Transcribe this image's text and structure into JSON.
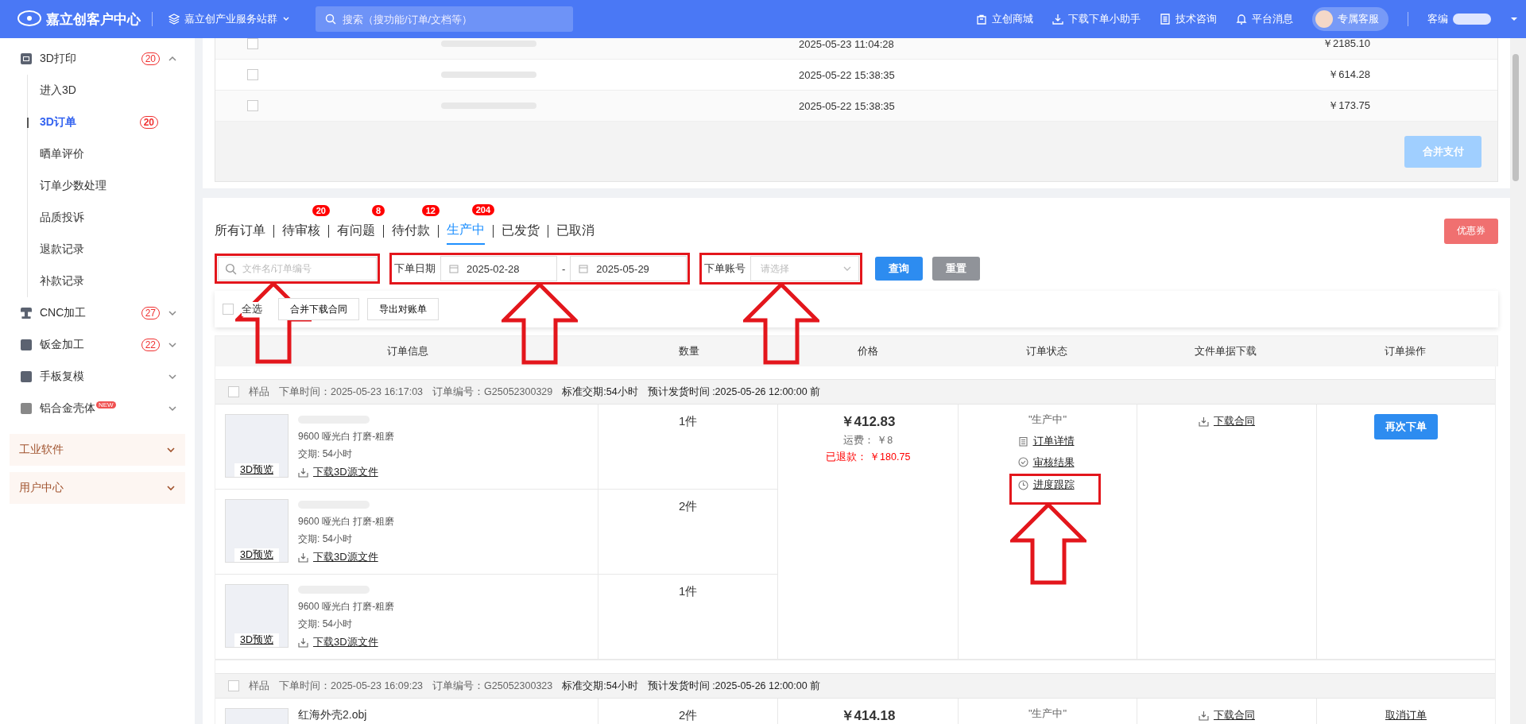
{
  "header": {
    "brand": "嘉立创客户中心",
    "site_switcher": "嘉立创产业服务站群",
    "search": {
      "placeholder": "搜索（搜功能/订单/文档等）"
    },
    "links": [
      {
        "kind": "shop",
        "label": "立创商城"
      },
      {
        "kind": "download",
        "label": "下载下单小助手"
      },
      {
        "kind": "doc",
        "label": "技术咨询"
      },
      {
        "kind": "bell",
        "label": "平台消息"
      }
    ],
    "service_button": "专属客服",
    "user_label": "客编"
  },
  "sidebar": {
    "items": [
      {
        "kind": "printer",
        "label": "3D打印",
        "badge": "20",
        "expanded": true,
        "children": [
          {
            "label": "进入3D",
            "selected": false
          },
          {
            "label": "3D订单",
            "badge": "20",
            "selected": true
          },
          {
            "label": "晒单评价",
            "selected": false
          },
          {
            "label": "订单少数处理",
            "selected": false
          },
          {
            "label": "品质投诉",
            "selected": false
          },
          {
            "label": "退款记录",
            "selected": false
          },
          {
            "label": "补款记录",
            "selected": false
          }
        ]
      },
      {
        "kind": "cnc",
        "label": "CNC加工",
        "badge": "27",
        "expanded": false
      },
      {
        "kind": "sheet",
        "label": "钣金加工",
        "badge": "22",
        "expanded": false
      },
      {
        "kind": "mold",
        "label": "手板复模",
        "expanded": false
      },
      {
        "kind": "box",
        "label": "铝合金壳体",
        "new_tag": "NEW",
        "expanded": false
      }
    ],
    "sections": [
      {
        "label": "工业软件"
      },
      {
        "label": "用户中心"
      }
    ]
  },
  "pending_payments": {
    "rows": [
      {
        "checked": false,
        "date": "2025-05-23 11:04:28",
        "amount": "￥2185.10"
      },
      {
        "checked": false,
        "date": "2025-05-22 15:38:35",
        "amount": "￥614.28"
      },
      {
        "checked": false,
        "date": "2025-05-22 15:38:35",
        "amount": "￥173.75"
      }
    ],
    "merge_button": {
      "label": "合并支付",
      "disabled": true
    }
  },
  "tabs": [
    {
      "label": "所有订单",
      "selected": false
    },
    {
      "label": "待审核",
      "badge": "20",
      "selected": false
    },
    {
      "label": "有问题",
      "badge": "8",
      "selected": false
    },
    {
      "label": "待付款",
      "badge": "12",
      "selected": false
    },
    {
      "label": "生产中",
      "badge": "204",
      "selected": true
    },
    {
      "label": "已发货",
      "selected": false
    },
    {
      "label": "已取消",
      "selected": false
    }
  ],
  "coupon_button": "优惠券",
  "filters": {
    "search": {
      "placeholder": "文件名/订单编号",
      "highlighted": true
    },
    "date_range": {
      "label": "下单日期",
      "from": "2025-02-28",
      "separator": "-",
      "to": "2025-05-29",
      "highlighted": true
    },
    "account": {
      "label": "下单账号",
      "placeholder": "请选择",
      "highlighted": true
    },
    "query_button": "查询",
    "reset_button": "重置"
  },
  "toolbar": {
    "select_all": {
      "label": "全选",
      "checked": false
    },
    "buttons": [
      "合并下载合同",
      "导出对账单"
    ]
  },
  "table": {
    "columns": [
      "订单信息",
      "数量",
      "价格",
      "订单状态",
      "文件单据下载",
      "订单操作"
    ]
  },
  "orders": [
    {
      "checked": false,
      "type": "样品",
      "placed": "下单时间：2025-05-23 16:17:03",
      "number": "订单编号：G25052300329",
      "lead_time": "标准交期:54小时",
      "ship_time": "预计发货时间 :2025-05-26 12:00:00 前",
      "items": [
        {
          "material": "9600  哑光白 打磨-粗磨",
          "lead": "交期: 54小时",
          "preview": "3D预览",
          "download": "下载3D源文件",
          "quantity": "1件"
        },
        {
          "material": "9600  哑光白 打磨-粗磨",
          "lead": "交期: 54小时",
          "preview": "3D预览",
          "download": "下载3D源文件",
          "quantity": "2件"
        },
        {
          "material": "9600  哑光白 打磨-粗磨",
          "lead": "交期: 54小时",
          "preview": "3D预览",
          "download": "下载3D源文件",
          "quantity": "1件"
        }
      ],
      "price": "￥412.83",
      "shipping": "运费： ￥8",
      "refund": "已退款： ￥180.75",
      "status": "\"生产中\"",
      "status_links": [
        {
          "kind": "detail",
          "label": "订单详情",
          "highlighted": false
        },
        {
          "kind": "review",
          "label": "审核结果",
          "highlighted": false
        },
        {
          "kind": "track",
          "label": "进度跟踪",
          "highlighted": true
        }
      ],
      "contract": "下载合同",
      "action": {
        "kind": "button",
        "label": "再次下单"
      }
    },
    {
      "checked": false,
      "type": "样品",
      "placed": "下单时间：2025-05-23 16:09:23",
      "number": "订单编号：G25052300323",
      "lead_time": "标准交期:54小时",
      "ship_time": "预计发货时间 :2025-05-26 12:00:00 前",
      "items": [
        {
          "name": "红海外壳2.obj",
          "quantity": "2件"
        }
      ],
      "price": "￥414.18",
      "status": "\"生产中\"",
      "contract": "下载合同",
      "action": {
        "kind": "link",
        "label": "取消订单"
      }
    }
  ]
}
